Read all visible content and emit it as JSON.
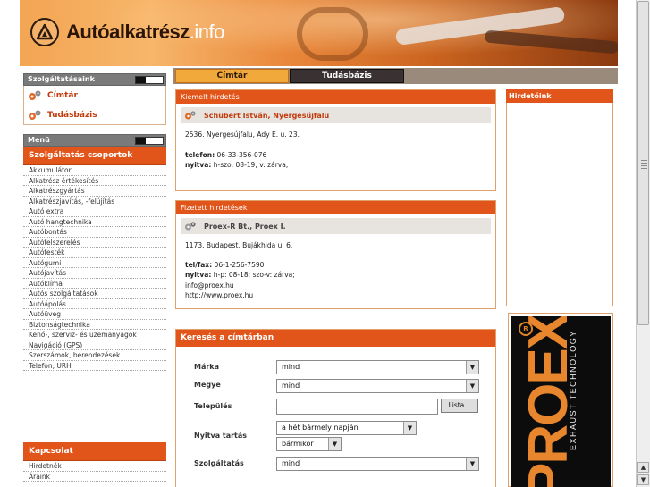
{
  "header": {
    "logo_main": "Autóalkatrész",
    "logo_tld": ".info"
  },
  "sidebar": {
    "services_title": "Szolgáltatásaink",
    "services": [
      {
        "label": "Címtár",
        "icon": "gears-icon"
      },
      {
        "label": "Tudásbázis",
        "icon": "gears-icon"
      }
    ],
    "menu_title": "Menü",
    "groups_title": "Szolgáltatás csoportok",
    "groups": [
      "Akkumulátor",
      "Alkatrész értékesítés",
      "Alkatrészgyártás",
      "Alkatrészjavítás, -felújítás",
      "Autó extra",
      "Autó hangtechnika",
      "Autóbontás",
      "Autófelszerelés",
      "Autófesték",
      "Autógumi",
      "Autójavítás",
      "Autóklíma",
      "Autós szolgáltatások",
      "Autóápolás",
      "Autóüveg",
      "Biztonságtechnika",
      "Kenő-, szerviz- és üzemanyagok",
      "Navigáció (GPS)",
      "Szerszámok, berendezések",
      "Telefon, URH"
    ],
    "contact_title": "Kapcsolat",
    "contact_items": [
      "Hirdetnék",
      "Áraink"
    ]
  },
  "tabs": [
    {
      "label": "Címtár",
      "active": true
    },
    {
      "label": "Tudásbázis",
      "active": false
    }
  ],
  "featured": {
    "title": "Kiemelt hirdetés",
    "company": "Schubert István, Nyergesújfalu",
    "address": "2536. Nyergesújfalu, Ady E. u. 23.",
    "phone_label": "telefon:",
    "phone": "06-33-356-076",
    "hours_label": "nyitva:",
    "hours": "h-szo: 08-19; v: zárva;"
  },
  "paid": {
    "title": "Fizetett hirdetések",
    "company": "Proex-R Bt., Proex I.",
    "address": "1173. Budapest, Bujákhida u. 6.",
    "phone_label": "tel/fax:",
    "phone": "06-1-256-7590",
    "hours_label": "nyitva:",
    "hours": "h-p: 08-18; szo-v: zárva;",
    "email": "info@proex.hu",
    "web": "http://www.proex.hu"
  },
  "search": {
    "title": "Keresés a címtárban",
    "brand_label": "Márka",
    "brand_value": "mind",
    "county_label": "Megye",
    "county_value": "mind",
    "city_label": "Település",
    "city_value": "",
    "list_button": "Lista...",
    "open_label": "Nyitva tartás",
    "open_day_value": "a hét bármely napján",
    "open_time_value": "bármikor",
    "service_label": "Szolgáltatás",
    "service_value": "mind"
  },
  "right": {
    "ads_title": "Hirdetőink",
    "banner_small": "EXHAUST TECHNOLOGY",
    "banner_big": "PROEX",
    "banner_mark": "R"
  },
  "colors": {
    "accent": "#e2551a",
    "link": "#c23a0c",
    "tab_active": "#f2a93b",
    "tab_inactive": "#3a3232"
  }
}
